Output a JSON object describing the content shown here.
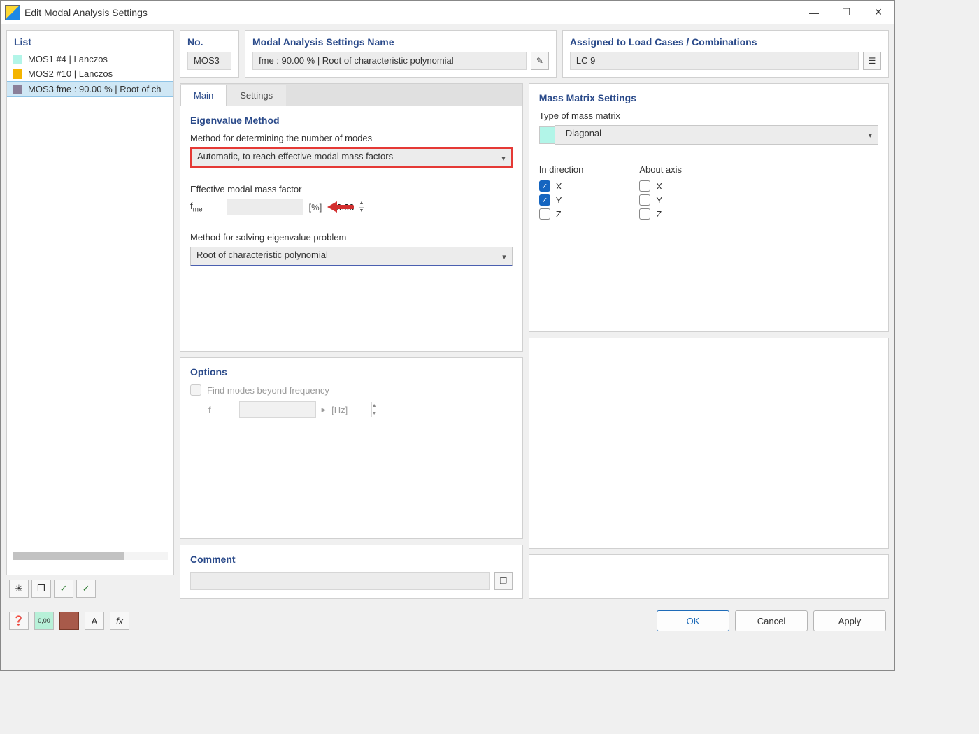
{
  "window": {
    "title": "Edit Modal Analysis Settings"
  },
  "list": {
    "header": "List",
    "items": [
      {
        "color": "#b2f5e8",
        "label": "MOS1  #4 | Lanczos"
      },
      {
        "color": "#f4b400",
        "label": "MOS2  #10 | Lanczos"
      },
      {
        "color": "#8a7f99",
        "label": "MOS3  fme : 90.00 % | Root of ch"
      }
    ],
    "selected_index": 2
  },
  "top": {
    "no_label": "No.",
    "no_value": "MOS3",
    "name_label": "Modal Analysis Settings Name",
    "name_value": "fme : 90.00 % | Root of characteristic polynomial",
    "assigned_label": "Assigned to Load Cases / Combinations",
    "assigned_value": "LC 9"
  },
  "tabs": {
    "main": "Main",
    "settings": "Settings"
  },
  "eigen": {
    "title": "Eigenvalue Method",
    "modes_label": "Method for determining the number of modes",
    "modes_value": "Automatic, to reach effective modal mass factors",
    "factor_label": "Effective modal mass factor",
    "fme_symbol": "fme",
    "fme_value": "90.00",
    "fme_unit": "[%]",
    "solver_label": "Method for solving eigenvalue problem",
    "solver_value": "Root of characteristic polynomial"
  },
  "options": {
    "title": "Options",
    "find_modes": "Find modes beyond frequency",
    "f_symbol": "f",
    "f_unit": "[Hz]"
  },
  "mass": {
    "title": "Mass Matrix Settings",
    "type_label": "Type of mass matrix",
    "type_value": "Diagonal",
    "in_direction": "In direction",
    "about_axis": "About axis",
    "axes": [
      "X",
      "Y",
      "Z"
    ],
    "direction_checked": {
      "X": true,
      "Y": true,
      "Z": false
    },
    "axis_checked": {
      "X": false,
      "Y": false,
      "Z": false
    }
  },
  "comment": {
    "title": "Comment",
    "value": ""
  },
  "footer": {
    "ok": "OK",
    "cancel": "Cancel",
    "apply": "Apply"
  }
}
